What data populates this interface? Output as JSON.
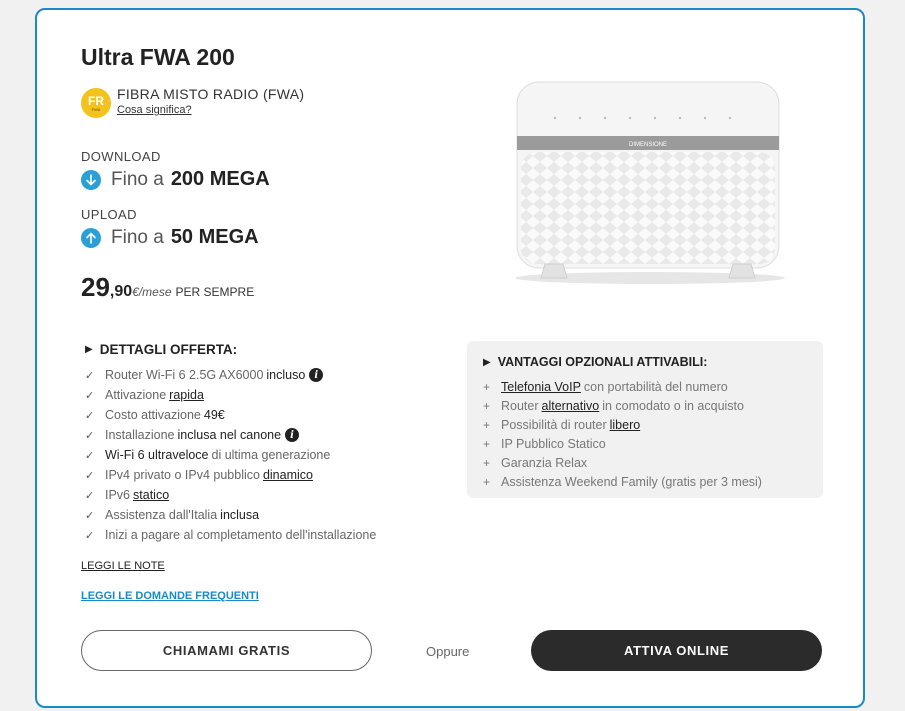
{
  "offer": {
    "title": "Ultra FWA 200",
    "technology": {
      "badge": "FR",
      "badge_sub": "FWA",
      "label": "FIBRA MISTO RADIO (FWA)",
      "link": "Cosa significa?"
    },
    "download": {
      "label": "DOWNLOAD",
      "prefix": "Fino a",
      "value": "200 MEGA"
    },
    "upload": {
      "label": "UPLOAD",
      "prefix": "Fino a",
      "value": "50 MEGA"
    },
    "price": {
      "integer": "29",
      "decimal": ",90",
      "unit": "€/mese",
      "period": "PER SEMPRE"
    },
    "router_brand": "DIMENSIONE"
  },
  "details": {
    "heading": "DETTAGLI OFFERTA:",
    "items": [
      {
        "text": "Router Wi-Fi 6 2.5G AX6000",
        "bold": "incluso"
      },
      {
        "text": "Attivazione",
        "link": "rapida"
      },
      {
        "text": "Costo attivazione",
        "bold": "49€"
      },
      {
        "text": "Installazione",
        "bold": "inclusa nel canone"
      },
      {
        "bold": "Wi-Fi 6 ultraveloce",
        "text": "di ultima generazione"
      },
      {
        "text": "IPv4 privato o IPv4 pubblico",
        "link": "dinamico"
      },
      {
        "text": "IPv6",
        "link": "statico"
      },
      {
        "text": "Assistenza dall'Italia",
        "bold": "inclusa"
      },
      {
        "text": "Inizi a pagare al completamento dell'installazione"
      }
    ]
  },
  "optional": {
    "heading": "VANTAGGI OPZIONALI ATTIVABILI:",
    "items": [
      {
        "link": "Telefonia VoIP",
        "text": "con portabilità del numero"
      },
      {
        "lead": "Router",
        "link": "alternativo",
        "text": "in comodato o in acquisto"
      },
      {
        "lead": "Possibilità di router",
        "link": "libero"
      },
      {
        "text": "IP Pubblico Statico"
      },
      {
        "text": "Garanzia Relax"
      },
      {
        "text": "Assistenza Weekend Family (gratis per 3 mesi)"
      }
    ]
  },
  "links": {
    "notes": "LEGGI LE NOTE",
    "faq": "LEGGI LE DOMANDE FREQUENTI"
  },
  "actions": {
    "call": "CHIAMAMI GRATIS",
    "or": "Oppure",
    "activate": "ATTIVA ONLINE"
  },
  "colors": {
    "accent": "#1a8ac6",
    "badge": "#f4c31b",
    "arrow": "#2a9fd8",
    "primary_button": "#2b2b2b"
  }
}
